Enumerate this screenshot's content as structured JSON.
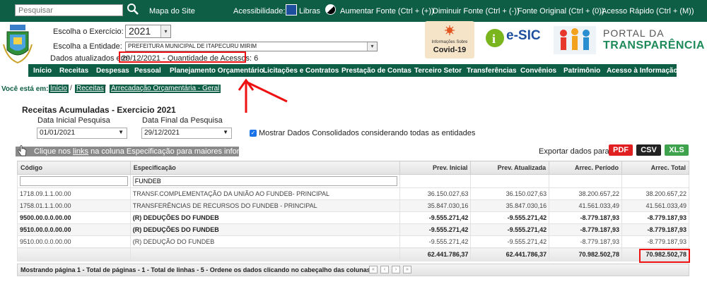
{
  "topbar": {
    "search_placeholder": "Pesquisar",
    "links": {
      "mapa": "Mapa do Site",
      "acessibilidade": "Acessibilidade:",
      "libras": "Libras",
      "aumentar": "Aumentar Fonte (Ctrl + (+))",
      "diminuir": "Diminuir Fonte (Ctrl + (-))",
      "original": "Fonte Original (Ctrl + (0))",
      "rapido": "Acesso Rápido (Ctrl + (M))"
    }
  },
  "header": {
    "exercicio_label": "Escolha o Exercício:",
    "exercicio_value": "2021",
    "entidade_label": "Escolha a Entidade:",
    "entidade_value": "PREFEITURA MUNICIPAL DE ITAPECURU MIRIM",
    "atualizados_label": "Dados atualizados em:",
    "atualizados_value": "29/12/2021 - Quantidade de Acessos: 6",
    "covid": {
      "line1": "Informações Sobre",
      "line2": "Covid-19"
    },
    "esic": {
      "title": "e-SIC"
    },
    "portal": {
      "line1": "PORTAL DA",
      "line2": "TRANSPARÊNCIA"
    }
  },
  "menu": [
    "Início",
    "Receitas",
    "Despesas",
    "Pessoal",
    "Planejamento Orçamentário",
    "Licitações e Contratos",
    "Prestação de Contas",
    "Terceiro Setor",
    "Transferências",
    "Convênios",
    "Patrimônio",
    "Acesso à Informação"
  ],
  "breadcrumb": {
    "label": "Você está em:",
    "items": [
      "Início",
      "Receitas",
      "Arrecadação Orçamentária - Geral"
    ]
  },
  "filters": {
    "title": "Receitas Acumuladas - Exercicio 2021",
    "data_inicial_label": "Data Inicial Pesquisa",
    "data_inicial_value": "01/01/2021",
    "data_final_label": "Data Final da Pesquisa",
    "data_final_value": "29/12/2021",
    "consolidado_label": "Mostrar Dados Consolidados considerando todas as entidades",
    "consolidado_checked": true
  },
  "info": {
    "pre": "Clique nos ",
    "link": "links",
    "post": " na coluna Especificação para maiores informações.",
    "export_label": "Exportar dados para:",
    "export_buttons": [
      "PDF",
      "CSV",
      "XLS"
    ],
    "export_colors": [
      "#e02020",
      "#222222",
      "#3fa34d"
    ]
  },
  "table": {
    "headers": [
      "Código",
      "Especificação",
      "Prev. Inicial",
      "Prev. Atualizada",
      "Arrec. Período",
      "Arrec. Total"
    ],
    "filter_codigo": "",
    "filter_especificacao": "FUNDEB",
    "rows": [
      {
        "codigo": "1718.09.1.1.00.00",
        "espec": "TRANSF.COMPLEMENTAÇÃO DA UNIÃO AO FUNDEB- PRINCIPAL",
        "prev_ini": "36.150.027,63",
        "prev_atu": "36.150.027,63",
        "arrec_per": "38.200.657,22",
        "arrec_tot": "38.200.657,22",
        "bold": false
      },
      {
        "codigo": "1758.01.1.1.00.00",
        "espec": "TRANSFERÊNCIAS DE RECURSOS DO FUNDEB - PRINCIPAL",
        "prev_ini": "35.847.030,16",
        "prev_atu": "35.847.030,16",
        "arrec_per": "41.561.033,49",
        "arrec_tot": "41.561.033,49",
        "bold": false
      },
      {
        "codigo": "9500.00.0.0.00.00",
        "espec": "(R) DEDUÇÕES DO FUNDEB",
        "prev_ini": "-9.555.271,42",
        "prev_atu": "-9.555.271,42",
        "arrec_per": "-8.779.187,93",
        "arrec_tot": "-8.779.187,93",
        "bold": true
      },
      {
        "codigo": "9510.00.0.0.00.00",
        "espec": "(R) DEDUÇÕES DO FUNDEB",
        "prev_ini": "-9.555.271,42",
        "prev_atu": "-9.555.271,42",
        "arrec_per": "-8.779.187,93",
        "arrec_tot": "-8.779.187,93",
        "bold": true
      },
      {
        "codigo": "9510.00.0.0.00.00",
        "espec": "(R) DEDUÇÃO DO FUNDEB",
        "prev_ini": "-9.555.271,42",
        "prev_atu": "-9.555.271,42",
        "arrec_per": "-8.779.187,93",
        "arrec_tot": "-8.779.187,93",
        "bold": false
      }
    ],
    "totals": {
      "prev_ini": "62.441.786,37",
      "prev_atu": "62.441.786,37",
      "arrec_per": "70.982.502,78",
      "arrec_tot": "70.982.502,78"
    },
    "footer": "Mostrando página 1 - Total de páginas - 1 - Total de linhas - 5 - Ordene os dados clicando no cabeçalho das colunas."
  }
}
